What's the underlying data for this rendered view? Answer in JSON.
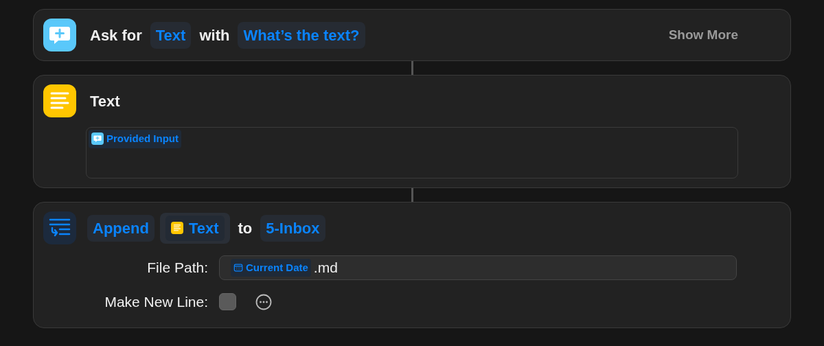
{
  "actions": [
    {
      "kind": "ask",
      "parts": [
        {
          "kind": "label",
          "text": "Ask for"
        },
        {
          "kind": "token",
          "text": "Text"
        },
        {
          "kind": "label",
          "text": "with"
        },
        {
          "kind": "token",
          "text": "What’s the text?"
        }
      ],
      "show_more": "Show More"
    },
    {
      "kind": "text",
      "parts": [
        {
          "kind": "label",
          "text": "Text"
        }
      ],
      "body": [
        {
          "kind": "input",
          "text": "Provided Input"
        }
      ]
    },
    {
      "kind": "append",
      "parts": [
        {
          "kind": "token",
          "text": "Append"
        },
        {
          "kind": "variable",
          "text": "Text"
        },
        {
          "kind": "label",
          "text": "to"
        },
        {
          "kind": "token",
          "text": "5-Inbox"
        }
      ],
      "fields": [
        {
          "kind": "path",
          "label": "File Path:",
          "tokens": [
            {
              "kind": "date",
              "text": "Current Date"
            }
          ],
          "suffix": ".md"
        },
        {
          "kind": "checkbox",
          "label": "Make New Line:",
          "checked": false
        }
      ]
    }
  ]
}
